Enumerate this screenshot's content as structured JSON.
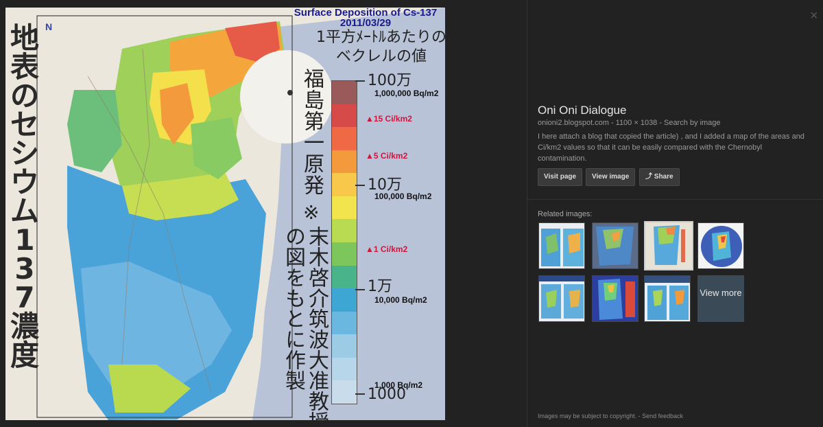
{
  "map": {
    "overlay_title": "Surface Deposition of Cs-137",
    "overlay_date": "2011/03/29",
    "vertical_title": "地表のセシウム137濃度",
    "legend_head_1": "1平方ﾒｰﾄﾙあたりの",
    "legend_head_2": "ベクレルの値",
    "plant": "福島第一原発",
    "note_mark": "※",
    "note": "末木啓介筑波大准教授の図をもとに作製",
    "compass": "N",
    "scale_labels": [
      "100万",
      "10万",
      "1万",
      "1000"
    ],
    "bq_labels": [
      "1,000,000 Bq/m2",
      "100,000 Bq/m2",
      "10,000 Bq/m2",
      "1,000 Bq/m2"
    ],
    "ci_labels": [
      "▲15 Ci/km2",
      "▲5 Ci/km2",
      "▲1 Ci/km2"
    ],
    "scale_colors": [
      "#9a5a5a",
      "#d64a4a",
      "#ef6a44",
      "#f39a3c",
      "#f7c84a",
      "#f2e44c",
      "#b8db52",
      "#7cc65c",
      "#49b38a",
      "#3ea6d2",
      "#6ab8e0",
      "#9ccbe6",
      "#b8d6ea",
      "#c9dcec"
    ]
  },
  "panel": {
    "close_icon": "×",
    "title": "Oni Oni Dialogue",
    "source": "onioni2.blogspot.com",
    "dims": "1100 × 1038",
    "sep": "-",
    "search_by_image": "Search by image",
    "description": "I here attach a blog that copied the article) , and I added a map of the areas and Ci/km2 values so that it can be easily compared with the Chernobyl contamination.",
    "buttons": {
      "visit": "Visit page",
      "view": "View image",
      "share": "Share"
    },
    "related_label": "Related images:",
    "view_more": "View more",
    "footer_text": "Images may be subject to copyright.",
    "footer_sep": "-",
    "feedback": "Send feedback"
  }
}
